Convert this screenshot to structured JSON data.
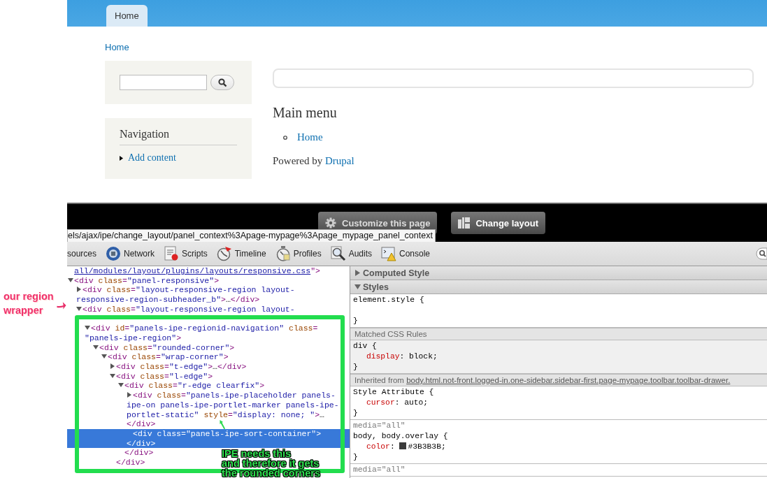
{
  "site": {
    "nav_tabs": [
      {
        "label": "Home",
        "selected": true
      }
    ],
    "breadcrumb": "Home",
    "sidebar": {
      "navigation": {
        "title": "Navigation",
        "links": [
          "Add content"
        ]
      }
    },
    "main": {
      "title": "Main menu",
      "links": [
        "Home"
      ],
      "footer": {
        "text": "Powered by",
        "link": "Drupal"
      }
    }
  },
  "ipe_toolbar": {
    "buttons": [
      {
        "label": "Customize this page"
      },
      {
        "label": "Change layout"
      }
    ],
    "tooltip": "els/ajax/ipe/change_layout/panel_context%3Apage-mypage%3Apage_mypage_panel_context"
  },
  "devtools": {
    "tabs": [
      {
        "label": "sources"
      },
      {
        "label": "Network"
      },
      {
        "label": "Scripts"
      },
      {
        "label": "Timeline"
      },
      {
        "label": "Profiles"
      },
      {
        "label": "Audits"
      },
      {
        "label": "Console"
      }
    ],
    "tree": [
      {
        "kind": "leaf",
        "selected": false,
        "parts": [
          {
            "kind": "link",
            "t": "all/modules/layout/plugins/layouts/responsive.css"
          },
          {
            "kind": "tag",
            "t": "\">"
          }
        ]
      },
      {
        "kind": "open",
        "expanded": true,
        "selected": false,
        "parts": [
          {
            "kind": "tag",
            "t": "<div"
          },
          {
            "kind": "attr",
            "t": " class"
          },
          {
            "kind": "tag",
            "t": "="
          },
          {
            "kind": "val",
            "t": "\"panel-responsive\""
          },
          {
            "kind": "tag",
            "t": ">"
          }
        ],
        "children": [
          {
            "kind": "open",
            "expanded": false,
            "selected": false,
            "parts": [
              {
                "kind": "tag",
                "t": "<div"
              },
              {
                "kind": "attr",
                "t": " class"
              },
              {
                "kind": "tag",
                "t": "="
              },
              {
                "kind": "val",
                "t": "\"layout-responsive-region layout-responsive-region-subheader_b\""
              },
              {
                "kind": "tag",
                "t": ">"
              },
              {
                "kind": "text",
                "t": "…"
              },
              {
                "kind": "tag",
                "t": "</div>"
              }
            ]
          },
          {
            "kind": "open",
            "expanded": true,
            "selected": false,
            "parts": [
              {
                "kind": "tag",
                "t": "<div"
              },
              {
                "kind": "attr",
                "t": " class"
              },
              {
                "kind": "tag",
                "t": "="
              },
              {
                "kind": "val",
                "t": "\"layout-responsive-region layout-"
              }
            ],
            "children": [
              {
                "kind": "open",
                "expanded": true,
                "selected": false,
                "parts": [
                  {
                    "kind": "tag",
                    "t": "<div"
                  },
                  {
                    "kind": "attr",
                    "t": " id"
                  },
                  {
                    "kind": "tag",
                    "t": "="
                  },
                  {
                    "kind": "val",
                    "t": "\"panels-ipe-regionid-navigation\""
                  },
                  {
                    "kind": "attr",
                    "t": " class"
                  },
                  {
                    "kind": "tag",
                    "t": "="
                  },
                  {
                    "kind": "val",
                    "t": "\"panels-ipe-region\""
                  },
                  {
                    "kind": "tag",
                    "t": ">"
                  }
                ],
                "children": [
                  {
                    "kind": "open",
                    "expanded": true,
                    "selected": false,
                    "parts": [
                      {
                        "kind": "tag",
                        "t": "<div"
                      },
                      {
                        "kind": "attr",
                        "t": " class"
                      },
                      {
                        "kind": "tag",
                        "t": "="
                      },
                      {
                        "kind": "val",
                        "t": "\"rounded-corner\""
                      },
                      {
                        "kind": "tag",
                        "t": ">"
                      }
                    ],
                    "children": [
                      {
                        "kind": "open",
                        "expanded": true,
                        "selected": false,
                        "parts": [
                          {
                            "kind": "tag",
                            "t": "<div"
                          },
                          {
                            "kind": "attr",
                            "t": " class"
                          },
                          {
                            "kind": "tag",
                            "t": "="
                          },
                          {
                            "kind": "val",
                            "t": "\"wrap-corner\""
                          },
                          {
                            "kind": "tag",
                            "t": ">"
                          }
                        ],
                        "children": [
                          {
                            "kind": "open",
                            "expanded": false,
                            "selected": false,
                            "parts": [
                              {
                                "kind": "tag",
                                "t": "<div"
                              },
                              {
                                "kind": "attr",
                                "t": " class"
                              },
                              {
                                "kind": "tag",
                                "t": "="
                              },
                              {
                                "kind": "val",
                                "t": "\"t-edge\""
                              },
                              {
                                "kind": "tag",
                                "t": ">"
                              },
                              {
                                "kind": "text",
                                "t": "…"
                              },
                              {
                                "kind": "tag",
                                "t": "</div>"
                              }
                            ]
                          },
                          {
                            "kind": "open",
                            "expanded": true,
                            "selected": false,
                            "parts": [
                              {
                                "kind": "tag",
                                "t": "<div"
                              },
                              {
                                "kind": "attr",
                                "t": " class"
                              },
                              {
                                "kind": "tag",
                                "t": "="
                              },
                              {
                                "kind": "val",
                                "t": "\"l-edge\""
                              },
                              {
                                "kind": "tag",
                                "t": ">"
                              }
                            ],
                            "children": [
                              {
                                "kind": "open",
                                "expanded": true,
                                "selected": false,
                                "parts": [
                                  {
                                    "kind": "tag",
                                    "t": "<div"
                                  },
                                  {
                                    "kind": "attr",
                                    "t": " class"
                                  },
                                  {
                                    "kind": "tag",
                                    "t": "="
                                  },
                                  {
                                    "kind": "val",
                                    "t": "\"r-edge clearfix\""
                                  },
                                  {
                                    "kind": "tag",
                                    "t": ">"
                                  }
                                ],
                                "children": [
                                  {
                                    "kind": "open",
                                    "expanded": false,
                                    "selected": false,
                                    "parts": [
                                      {
                                        "kind": "tag",
                                        "t": "<div"
                                      },
                                      {
                                        "kind": "attr",
                                        "t": " class"
                                      },
                                      {
                                        "kind": "tag",
                                        "t": "="
                                      },
                                      {
                                        "kind": "val",
                                        "t": "\"panels-ipe-placeholder panels-ipe-on panels-ipe-portlet-marker panels-ipe-portlet-static\""
                                      },
                                      {
                                        "kind": "attr",
                                        "t": " style"
                                      },
                                      {
                                        "kind": "tag",
                                        "t": "="
                                      },
                                      {
                                        "kind": "val",
                                        "t": "\"display: none; \""
                                      },
                                      {
                                        "kind": "tag",
                                        "t": ">"
                                      },
                                      {
                                        "kind": "text",
                                        "t": "…"
                                      },
                                      {
                                        "kind": "tag",
                                        "t": "</div>"
                                      }
                                    ]
                                  },
                                  {
                                    "kind": "leaf",
                                    "selected": true,
                                    "parts": [
                                      {
                                        "kind": "tag",
                                        "t": "<div"
                                      },
                                      {
                                        "kind": "attr",
                                        "t": " class"
                                      },
                                      {
                                        "kind": "tag",
                                        "t": "="
                                      },
                                      {
                                        "kind": "val",
                                        "t": "\"panels-ipe-sort-container\""
                                      },
                                      {
                                        "kind": "tag",
                                        "t": "></div>"
                                      }
                                    ]
                                  }
                                ]
                              },
                              {
                                "kind": "close",
                                "selected": false,
                                "parts": [
                                  {
                                    "kind": "tag",
                                    "t": "</div>"
                                  }
                                ]
                              }
                            ]
                          },
                          {
                            "kind": "close",
                            "selected": false,
                            "parts": [
                              {
                                "kind": "tag",
                                "t": "</div>"
                              }
                            ]
                          }
                        ]
                      }
                    ]
                  }
                ]
              }
            ]
          }
        ]
      }
    ],
    "styles": [
      {
        "kind": "header",
        "label": "Computed Style",
        "expanded": false
      },
      {
        "kind": "header",
        "label": "Styles",
        "expanded": true
      },
      {
        "kind": "rule",
        "shaded": false,
        "selector": "element.style {",
        "close": "}"
      },
      {
        "kind": "subheader",
        "label": "Matched CSS Rules"
      },
      {
        "kind": "rule",
        "shaded": true,
        "selector": "div {",
        "properties": [
          {
            "name": "display",
            "sep": ":",
            "value": "block;"
          }
        ],
        "close": "}"
      },
      {
        "kind": "subheader",
        "label": "Inherited from",
        "link": "body.html.not-front.logged-in.one-sidebar.sidebar-first.page-mypage.toolbar.toolbar-drawer."
      },
      {
        "kind": "rule",
        "shaded": false,
        "selector": "Style Attribute {",
        "properties": [
          {
            "name": "cursor",
            "sep": ":",
            "value": "auto;"
          }
        ],
        "close": "}"
      },
      {
        "kind": "rule",
        "shaded": false,
        "media": "media=\"all\"",
        "selector": "body, body.overlay {",
        "properties": [
          {
            "name": "color",
            "sep": ":",
            "color": "#3b3b3b",
            "value": "#3B3B3B;"
          }
        ],
        "close": "}"
      },
      {
        "kind": "rule",
        "shaded": false,
        "media": "media=\"all\""
      }
    ]
  },
  "annotations": [
    {
      "kind": "red",
      "text": "our region\nwrapper"
    },
    {
      "kind": "green",
      "text": "IPE needs this\nand therefore it gets\nthe rounded corners"
    }
  ]
}
